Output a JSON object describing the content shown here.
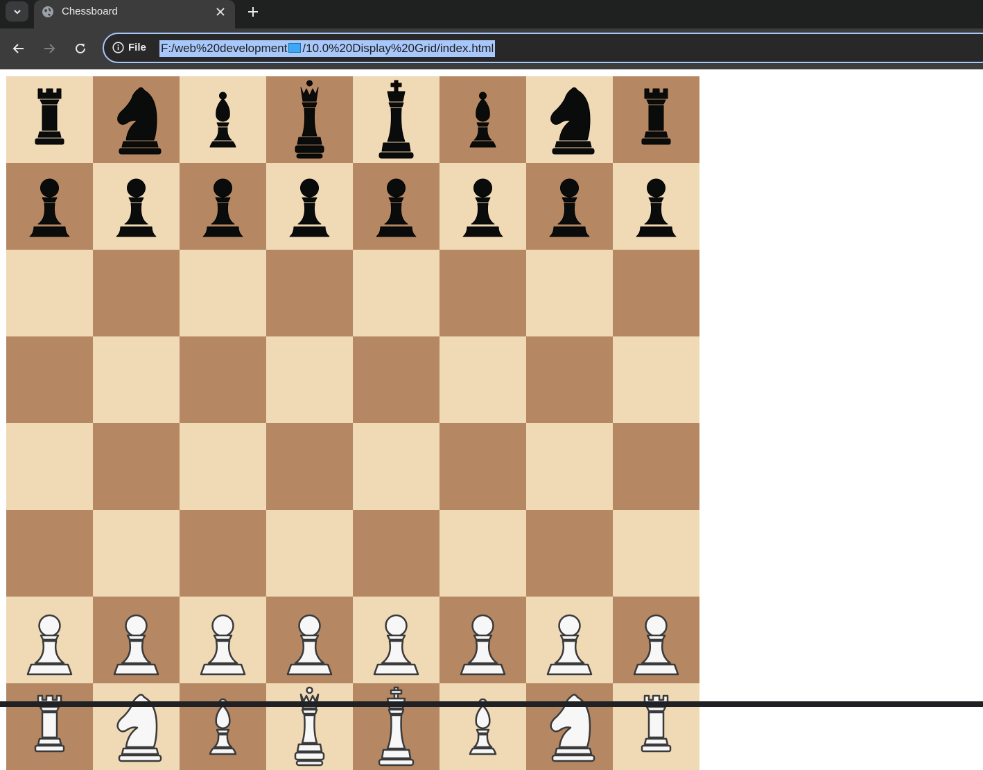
{
  "tab": {
    "title": "Chessboard",
    "favicon": "globe-icon",
    "close_icon": "close-icon"
  },
  "newtab_icon": "plus-icon",
  "toolbar": {
    "back_icon": "arrow-left-icon",
    "forward_icon": "arrow-right-icon",
    "reload_icon": "reload-icon"
  },
  "omnibox": {
    "scheme_label": "File",
    "info_icon": "info-icon",
    "url_part1": "F:/web%20development",
    "url_emoji_icon": "desktop-computer-icon",
    "url_part2": "/10.0%20Display%20Grid/index.html"
  },
  "board": {
    "light_color": "#f0d9b5",
    "dark_color": "#b58863",
    "ranks": [
      [
        "black-rook",
        "black-knight",
        "black-bishop",
        "black-queen",
        "black-king",
        "black-bishop",
        "black-knight",
        "black-rook"
      ],
      [
        "black-pawn",
        "black-pawn",
        "black-pawn",
        "black-pawn",
        "black-pawn",
        "black-pawn",
        "black-pawn",
        "black-pawn"
      ],
      [
        "",
        "",
        "",
        "",
        "",
        "",
        "",
        ""
      ],
      [
        "",
        "",
        "",
        "",
        "",
        "",
        "",
        ""
      ],
      [
        "",
        "",
        "",
        "",
        "",
        "",
        "",
        ""
      ],
      [
        "",
        "",
        "",
        "",
        "",
        "",
        "",
        ""
      ],
      [
        "white-pawn",
        "white-pawn",
        "white-pawn",
        "white-pawn",
        "white-pawn",
        "white-pawn",
        "white-pawn",
        "white-pawn"
      ],
      [
        "white-rook",
        "white-knight",
        "white-bishop",
        "white-queen",
        "white-king",
        "white-bishop",
        "white-knight",
        "white-rook"
      ]
    ]
  }
}
